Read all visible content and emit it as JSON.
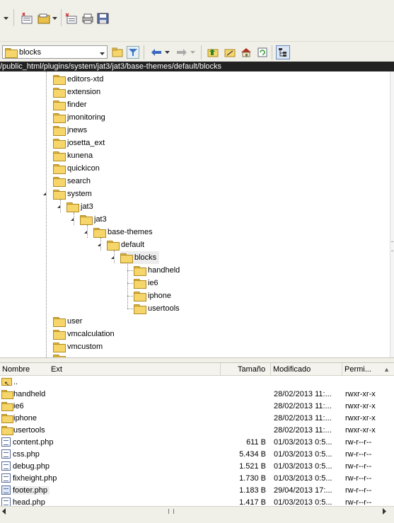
{
  "location": {
    "current_folder": "blocks",
    "path": "/public_html/plugins/system/jat3/jat3/base-themes/default/blocks"
  },
  "tree": [
    {
      "label": "editors-xtd"
    },
    {
      "label": "extension"
    },
    {
      "label": "finder"
    },
    {
      "label": "jmonitoring"
    },
    {
      "label": "jnews"
    },
    {
      "label": "josetta_ext"
    },
    {
      "label": "kunena"
    },
    {
      "label": "quickicon"
    },
    {
      "label": "search"
    },
    {
      "label": "system"
    },
    {
      "label": "jat3"
    },
    {
      "label": "jat3"
    },
    {
      "label": "base-themes"
    },
    {
      "label": "default"
    },
    {
      "label": "blocks"
    },
    {
      "label": "handheld"
    },
    {
      "label": "ie6"
    },
    {
      "label": "iphone"
    },
    {
      "label": "usertools"
    },
    {
      "label": "user"
    },
    {
      "label": "vmcalculation"
    },
    {
      "label": "vmcustom"
    }
  ],
  "columns": {
    "name": "Nombre",
    "ext": "Ext",
    "size": "Tamaño",
    "modified": "Modificado",
    "perms": "Permi..."
  },
  "files": [
    {
      "name": "..",
      "size": "",
      "modified": "",
      "perms": "",
      "kind": "up"
    },
    {
      "name": "handheld",
      "size": "",
      "modified": "28/02/2013 11:...",
      "perms": "rwxr-xr-x",
      "kind": "folder"
    },
    {
      "name": "ie6",
      "size": "",
      "modified": "28/02/2013 11:...",
      "perms": "rwxr-xr-x",
      "kind": "folder"
    },
    {
      "name": "iphone",
      "size": "",
      "modified": "28/02/2013 11:...",
      "perms": "rwxr-xr-x",
      "kind": "folder"
    },
    {
      "name": "usertools",
      "size": "",
      "modified": "28/02/2013 11:...",
      "perms": "rwxr-xr-x",
      "kind": "folder"
    },
    {
      "name": "content.php",
      "size": "611 B",
      "modified": "01/03/2013 0:5...",
      "perms": "rw-r--r--",
      "kind": "file"
    },
    {
      "name": "css.php",
      "size": "5.434 B",
      "modified": "01/03/2013 0:5...",
      "perms": "rw-r--r--",
      "kind": "file"
    },
    {
      "name": "debug.php",
      "size": "1.521 B",
      "modified": "01/03/2013 0:5...",
      "perms": "rw-r--r--",
      "kind": "file"
    },
    {
      "name": "fixheight.php",
      "size": "1.730 B",
      "modified": "01/03/2013 0:5...",
      "perms": "rw-r--r--",
      "kind": "file"
    },
    {
      "name": "footer.php",
      "size": "1.183 B",
      "modified": "29/04/2013 17:...",
      "perms": "rw-r--r--",
      "kind": "file"
    },
    {
      "name": "head.php",
      "size": "1.417 B",
      "modified": "01/03/2013 0:5...",
      "perms": "rw-r--r--",
      "kind": "file"
    }
  ]
}
